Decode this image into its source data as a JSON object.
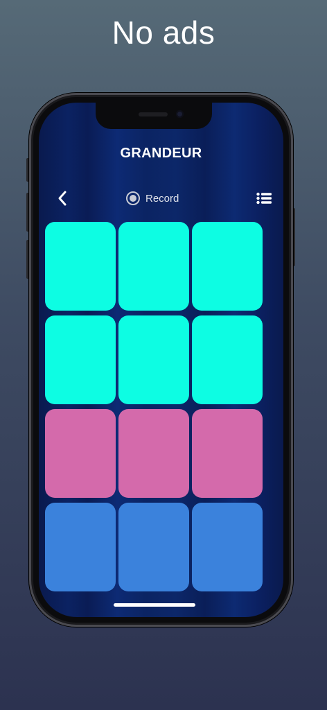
{
  "headline": "No ads",
  "app": {
    "title": "GRANDEUR",
    "record_label": "Record",
    "icons": {
      "back": "chevron-left-icon",
      "record": "record-icon",
      "list": "list-icon"
    }
  },
  "colors": {
    "pad_cyan": "#0dfde3",
    "pad_pink": "#d46aab",
    "pad_blue": "#3b82dc"
  },
  "pads": [
    {
      "color": "#0dfde3"
    },
    {
      "color": "#0dfde3"
    },
    {
      "color": "#0dfde3"
    },
    {
      "color": "#0dfde3"
    },
    {
      "color": "#0dfde3"
    },
    {
      "color": "#0dfde3"
    },
    {
      "color": "#d46aab"
    },
    {
      "color": "#d46aab"
    },
    {
      "color": "#d46aab"
    },
    {
      "color": "#3b82dc"
    },
    {
      "color": "#3b82dc"
    },
    {
      "color": "#3b82dc"
    }
  ]
}
